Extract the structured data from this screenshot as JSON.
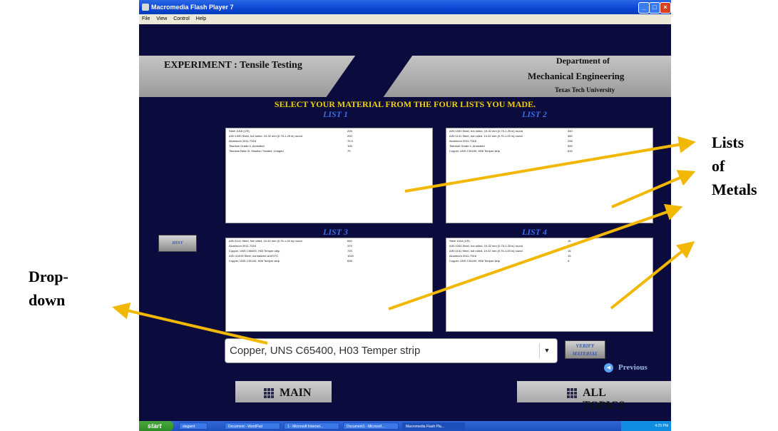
{
  "window": {
    "title": "Macromedia Flash Player 7"
  },
  "menubar": [
    "File",
    "View",
    "Control",
    "Help"
  ],
  "header": {
    "title": "EXPERIMENT : Tensile Testing",
    "dept_line1": "Department of",
    "dept_line2": "Mechanical Engineering",
    "dept_line3": "Texas Tech University"
  },
  "instruction": "SELECT YOUR MATERIAL FROM THE FOUR LISTS YOU MADE.",
  "lists": [
    {
      "label": "LIST 1",
      "items": [
        {
          "name": "Steel 1018 (CR)",
          "value": "205"
        },
        {
          "name": "AISI 1050 Steel, hot rolled, 19-32 mm (0.75-1.25 in) round",
          "value": "200"
        },
        {
          "name": "Aluminum 2011-T316",
          "value": "70.3"
        },
        {
          "name": "Titanium Grade 4, Annealed",
          "value": "105"
        },
        {
          "name": "Titanium Beta III, Solution Treated, Unaged",
          "value": "79"
        }
      ]
    },
    {
      "label": "LIST 2",
      "items": [
        {
          "name": "AISI 1050 Steel, hot rolled, 19-32 mm (0.75-1.25 in) round",
          "value": "340"
        },
        {
          "name": "AISI 1141 Steel, hot rolled, 19-32 mm (0.75-1.25 in) round",
          "value": "360"
        },
        {
          "name": "Aluminum 2011-T316",
          "value": "296"
        },
        {
          "name": "Titanium Grade 4, Annealed",
          "value": "590"
        },
        {
          "name": "Copper, UNS C51100, H06 Temper strip",
          "value": "615"
        }
      ]
    },
    {
      "label": "LIST 3",
      "items": [
        {
          "name": "AISI 1141 Steel, hot rolled, 19-32 mm (0.75-1.25 in) round",
          "value": "650"
        },
        {
          "name": "Aluminum 2011-T316",
          "value": "379"
        },
        {
          "name": "Copper, UNS C65400, H03 Temper strip",
          "value": "725"
        },
        {
          "name": "AISI 4140H Steel, normalized at 870°C",
          "value": "1020"
        },
        {
          "name": "Copper, UNS C51100, H06 Temper strip",
          "value": "635"
        }
      ]
    },
    {
      "label": "LIST 4",
      "items": [
        {
          "name": "Steel 1018 (CR)",
          "value": "15"
        },
        {
          "name": "AISI 1050 Steel, hot rolled, 19-32 mm (0.75-1.25 in) round",
          "value": ""
        },
        {
          "name": "AISI 1141 Steel, hot rolled, 19-32 mm (0.75-1.25 in) round",
          "value": "15"
        },
        {
          "name": "Aluminum 2011-T316",
          "value": "15"
        },
        {
          "name": "Copper, UNS C51100, H06 Temper strip",
          "value": "4"
        }
      ]
    }
  ],
  "hint_label": "HINT",
  "dropdown": {
    "selected": "Copper, UNS C65400, H03 Temper strip"
  },
  "verify": {
    "line1": "VERIFY",
    "line2": "MATERIAL"
  },
  "previous_label": "Previous",
  "footer": {
    "main_label": "MAIN",
    "alltopics_label": "ALL TOPICS"
  },
  "taskbar": {
    "start_label": "start",
    "items": [
      "stagwnt",
      "Document - WordPad",
      "1 - Microsoft Internet...",
      "Document1 - Microsof...",
      "Macromedia Flash Pla..."
    ],
    "clock": "4:25 PM"
  },
  "annotations": {
    "lists_of_metals": [
      "Lists",
      "of",
      "Metals"
    ],
    "dropdown": [
      "Drop-",
      "down"
    ]
  },
  "colors": {
    "stage_bg": "#0b0b3e",
    "instruction": "#f0d000",
    "list_label": "#3a6de0",
    "arrow": "#f2b800"
  }
}
